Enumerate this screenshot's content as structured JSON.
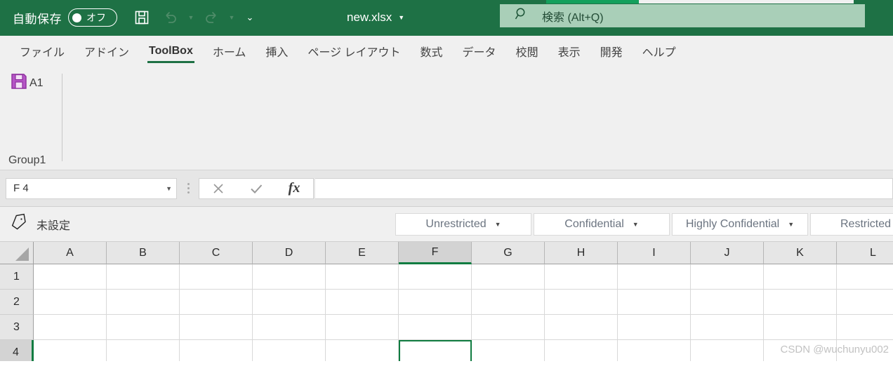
{
  "titlebar": {
    "autosave_label": "自動保存",
    "autosave_state": "オフ",
    "save_icon": "save-floppy-icon",
    "undo_icon": "undo-arrow-icon",
    "redo_icon": "redo-arrow-icon",
    "customize_icon": "customize-quick-access-chevron-icon",
    "filename": "new.xlsx",
    "filename_caret": "▼",
    "search_icon": "search-magnifier-icon",
    "search_placeholder": "検索 (Alt+Q)",
    "search_value": "",
    "accent_color": "#1e7145",
    "search_bg": "#a9cfb8"
  },
  "ribbon": {
    "tabs": [
      {
        "label": "ファイル",
        "active": false
      },
      {
        "label": "アドイン",
        "active": false
      },
      {
        "label": "ToolBox",
        "active": true
      },
      {
        "label": "ホーム",
        "active": false
      },
      {
        "label": "挿入",
        "active": false
      },
      {
        "label": "ページ レイアウト",
        "active": false
      },
      {
        "label": "数式",
        "active": false
      },
      {
        "label": "データ",
        "active": false
      },
      {
        "label": "校閲",
        "active": false
      },
      {
        "label": "表示",
        "active": false
      },
      {
        "label": "開発",
        "active": false
      },
      {
        "label": "ヘルプ",
        "active": false
      }
    ],
    "active_tab_underline_color": "#1e7145",
    "group": {
      "name": "Group1",
      "button_label": "A1",
      "button_icon": "purple-floppy-save-icon",
      "button_icon_color": "#b04ec0"
    }
  },
  "formula_bar": {
    "namebox_value": "F 4",
    "namebox_caret": "▼",
    "cancel_icon": "cancel-x-icon",
    "cancel_glyph": "✕",
    "enter_icon": "enter-check-icon",
    "enter_glyph": "✓",
    "function_icon": "insert-function-fx-icon",
    "function_glyph": "fx",
    "formula_value": ""
  },
  "sensitivity_bar": {
    "tag_icon": "sensitivity-tag-icon",
    "status_label": "未設定",
    "buttons": [
      {
        "label": "Unrestricted",
        "caret": "▼"
      },
      {
        "label": "Confidential",
        "caret": "▼"
      },
      {
        "label": "Highly Confidential",
        "caret": "▼"
      },
      {
        "label": "Restricted",
        "caret": "▼"
      }
    ]
  },
  "grid": {
    "columns": [
      "A",
      "B",
      "C",
      "D",
      "E",
      "F",
      "G",
      "H",
      "I",
      "J",
      "K",
      "L"
    ],
    "rows": [
      "1",
      "2",
      "3",
      "4"
    ],
    "selected_column": "F",
    "selected_row": "4",
    "active_cell": "F4",
    "selection_color": "#107c41",
    "cells": [
      [
        "",
        "",
        "",
        "",
        "",
        "",
        "",
        "",
        "",
        "",
        "",
        ""
      ],
      [
        "",
        "",
        "",
        "",
        "",
        "",
        "",
        "",
        "",
        "",
        "",
        ""
      ],
      [
        "",
        "",
        "",
        "",
        "",
        "",
        "",
        "",
        "",
        "",
        "",
        ""
      ],
      [
        "",
        "",
        "",
        "",
        "",
        "",
        "",
        "",
        "",
        "",
        "",
        ""
      ]
    ]
  },
  "watermark": {
    "text": "CSDN @wuchunyu002"
  }
}
